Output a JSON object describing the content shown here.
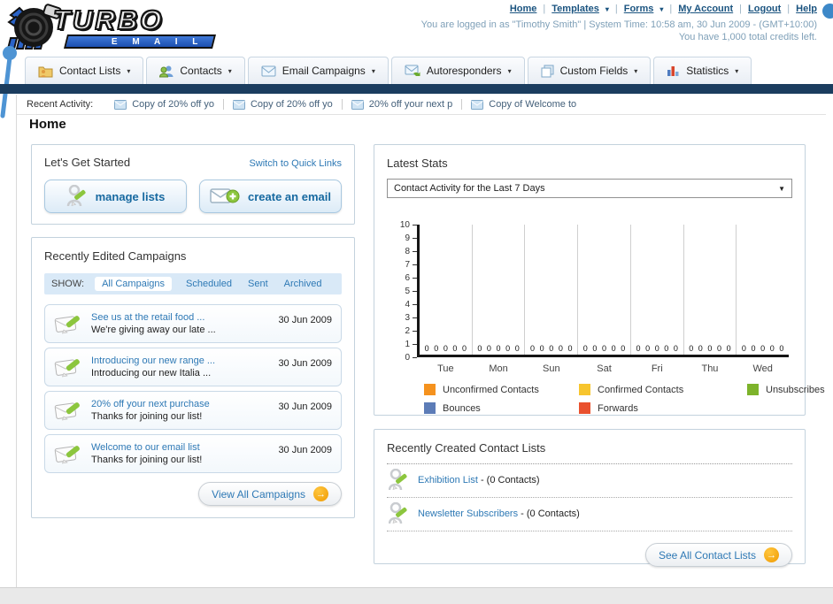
{
  "brand": {
    "top": "TURBO",
    "bottom": "E M A I L"
  },
  "icons": {
    "caret_down": "▾",
    "caret_select": "▼",
    "arrow_right": "→"
  },
  "header": {
    "separator": "|",
    "links": [
      {
        "label": "Home"
      },
      {
        "label": "Templates",
        "dropdown": true
      },
      {
        "label": "Forms",
        "dropdown": true
      },
      {
        "label": "My Account"
      },
      {
        "label": "Logout"
      },
      {
        "label": "Help"
      }
    ],
    "login_line": "You are logged in as \"Timothy Smith\" | System Time: 10:58 am, 30 Jun 2009 - (GMT+10:00)",
    "credits_line": "You have 1,000 total credits left."
  },
  "tabs": [
    {
      "label": "Contact Lists"
    },
    {
      "label": "Contacts"
    },
    {
      "label": "Email Campaigns"
    },
    {
      "label": "Autoresponders"
    },
    {
      "label": "Custom Fields"
    },
    {
      "label": "Statistics"
    }
  ],
  "recent_activity": {
    "label": "Recent Activity:",
    "items": [
      {
        "label": "Copy of 20% off yo"
      },
      {
        "label": "Copy of 20% off yo"
      },
      {
        "label": "20% off your next p"
      },
      {
        "label": "Copy of Welcome to"
      }
    ]
  },
  "page_title": "Home",
  "get_started": {
    "title": "Let's Get Started",
    "switch_link": "Switch to Quick Links",
    "manage_lists_label": "manage lists",
    "create_email_label": "create an email"
  },
  "campaigns": {
    "title": "Recently Edited Campaigns",
    "show_label": "SHOW:",
    "filters": [
      {
        "label": "All Campaigns",
        "active": true
      },
      {
        "label": "Scheduled"
      },
      {
        "label": "Sent"
      },
      {
        "label": "Archived"
      }
    ],
    "items": [
      {
        "title": "See us at the retail food ...",
        "subtitle": "We're giving away our late ...",
        "date": "30 Jun 2009"
      },
      {
        "title": "Introducing our new range ...",
        "subtitle": "Introducing our new Italia ...",
        "date": "30 Jun 2009"
      },
      {
        "title": "20% off your next purchase",
        "subtitle": "Thanks for joining our list!",
        "date": "30 Jun 2009"
      },
      {
        "title": "Welcome to our email list",
        "subtitle": "Thanks for joining our list!",
        "date": "30 Jun 2009"
      }
    ],
    "view_all_label": "View All Campaigns"
  },
  "stats": {
    "title": "Latest Stats",
    "dropdown_value": "Contact Activity for the Last 7 Days",
    "chart_data": {
      "type": "bar",
      "title": "Contact Activity for the Last 7 Days",
      "categories": [
        "Tue",
        "Mon",
        "Sun",
        "Sat",
        "Fri",
        "Thu",
        "Wed"
      ],
      "series": [
        {
          "name": "Unconfirmed Contacts",
          "color": "#F5921E",
          "values": [
            0,
            0,
            0,
            0,
            0,
            0,
            0
          ]
        },
        {
          "name": "Confirmed Contacts",
          "color": "#F7C52E",
          "values": [
            0,
            0,
            0,
            0,
            0,
            0,
            0
          ]
        },
        {
          "name": "Unsubscribes",
          "color": "#7DB32B",
          "values": [
            0,
            0,
            0,
            0,
            0,
            0,
            0
          ]
        },
        {
          "name": "Bounces",
          "color": "#5C7CB7",
          "values": [
            0,
            0,
            0,
            0,
            0,
            0,
            0
          ]
        },
        {
          "name": "Forwards",
          "color": "#E9512E",
          "values": [
            0,
            0,
            0,
            0,
            0,
            0,
            0
          ]
        }
      ],
      "ylim": [
        0,
        10
      ],
      "y_ticks": [
        10,
        9,
        8,
        7,
        6,
        5,
        4,
        3,
        2,
        1,
        0
      ],
      "grid": true,
      "legend_position": "bottom"
    }
  },
  "contact_lists": {
    "title": "Recently Created Contact Lists",
    "items": [
      {
        "name": "Exhibition List",
        "count_text": "- (0 Contacts)"
      },
      {
        "name": "Newsletter Subscribers",
        "count_text": "- (0 Contacts)"
      }
    ],
    "see_all_label": "See All Contact Lists"
  }
}
